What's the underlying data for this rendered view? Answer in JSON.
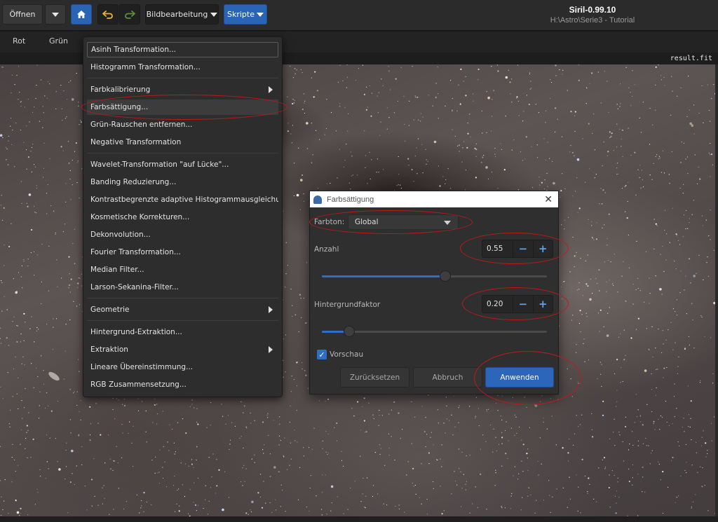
{
  "header": {
    "open_label": "Öffnen",
    "image_processing_label": "Bildbearbeitung",
    "scripts_label": "Skripte",
    "app_title": "Siril-0.99.10",
    "project_path": "H:\\Astro\\Serie3 - Tutorial",
    "icons": [
      "chevron-down-icon",
      "home-icon",
      "undo-icon",
      "redo-icon"
    ]
  },
  "tabs": [
    "Rot",
    "Grün"
  ],
  "image": {
    "filename": "result.fit"
  },
  "menu": {
    "items": [
      {
        "label": "Asinh Transformation..."
      },
      {
        "label": "Histogramm Transformation..."
      },
      {
        "label": "Farbkalibrierung"
      },
      {
        "label": "Farbsättigung..."
      },
      {
        "label": "Grün-Rauschen entfernen..."
      },
      {
        "label": "Negative Transformation"
      },
      {
        "label": "Wavelet-Transformation \"auf Lücke\"..."
      },
      {
        "label": "Banding Reduzierung..."
      },
      {
        "label": "Kontrastbegrenzte adaptive Histogrammausgleichung....."
      },
      {
        "label": "Kosmetische Korrekturen..."
      },
      {
        "label": "Dekonvolution..."
      },
      {
        "label": "Fourier Transformation..."
      },
      {
        "label": "Median Filter..."
      },
      {
        "label": "Larson-Sekanina-Filter..."
      },
      {
        "label": "Geometrie"
      },
      {
        "label": "Hintergrund-Extraktion..."
      },
      {
        "label": "Extraktion"
      },
      {
        "label": "Lineare Übereinstimmung..."
      },
      {
        "label": "RGB Zusammensetzung..."
      }
    ]
  },
  "dialog": {
    "title": "Farbsättigung",
    "hue_label": "Farbton:",
    "hue_value": "Global",
    "amount_label": "Anzahl",
    "amount_value": "0.55",
    "amount_level": 0.55,
    "background_label": "Hintergrundfaktor",
    "background_value": "0.20",
    "background_level": 0.1,
    "minus": "−",
    "plus": "+",
    "preview_label": "Vorschau",
    "preview_checked": true,
    "reset_label": "Zurücksetzen",
    "cancel_label": "Abbruch",
    "apply_label": "Anwenden",
    "close_glyph": "✕",
    "check_glyph": "✓"
  },
  "colors": {
    "accent": "#2b66bb",
    "annotation": "#c21919"
  }
}
